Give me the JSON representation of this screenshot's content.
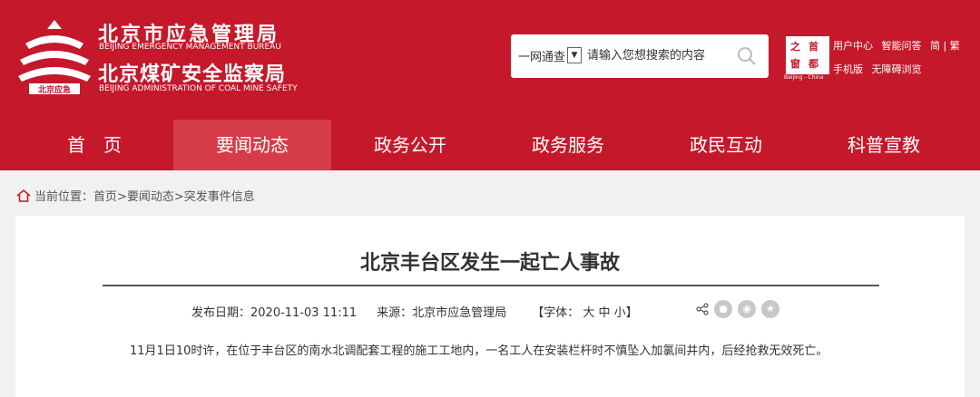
{
  "header": {
    "org_cn_1": "北京市应急管理局",
    "org_en_1": "BEIJING EMERGENCY MANAGEMENT BUREAU",
    "org_cn_2": "北京煤矿安全监察局",
    "org_en_2": "BEIJING ADMINISTRATION OF COAL MINE SAFETY",
    "logo_text": "北京应急",
    "search": {
      "scope": "一网通查",
      "placeholder": "请输入您想搜索的内容"
    },
    "capital_logo": {
      "chars": [
        "之",
        "首",
        "窗",
        "都"
      ],
      "subtitle": "Beijing - China"
    },
    "links_row1": [
      "用户中心",
      "智能问答",
      "简 | 繁"
    ],
    "links_row2": [
      "手机版",
      "无障碍浏览"
    ]
  },
  "nav": {
    "items": [
      "首　页",
      "要闻动态",
      "政务公开",
      "政务服务",
      "政民互动",
      "科普宣教"
    ],
    "active_index": 1
  },
  "breadcrumb": {
    "label": "当前位置：",
    "path": "首页>要闻动态>突发事件信息"
  },
  "article": {
    "title": "北京丰台区发生一起亡人事故",
    "date_label": "发布日期：",
    "date": "2020-11-03 11:11",
    "source_label": "来源：",
    "source": "北京市应急管理局",
    "font_label": "【字体：",
    "font_large": "大",
    "font_medium": "中",
    "font_small": "小",
    "font_close": "】",
    "body": "11月1日10时许，在位于丰台区的南水北调配套工程的施工工地内，一名工人在安装栏杆时不慎坠入加氯间井内，后经抢救无效死亡。"
  },
  "colors": {
    "brand_red": "#c5182b",
    "nav_active": "#d63b4a",
    "page_bg": "#f1f1f1"
  },
  "icons": [
    "search-icon",
    "home-icon",
    "share-icon",
    "wechat-icon",
    "weibo-icon",
    "favorite-icon"
  ]
}
